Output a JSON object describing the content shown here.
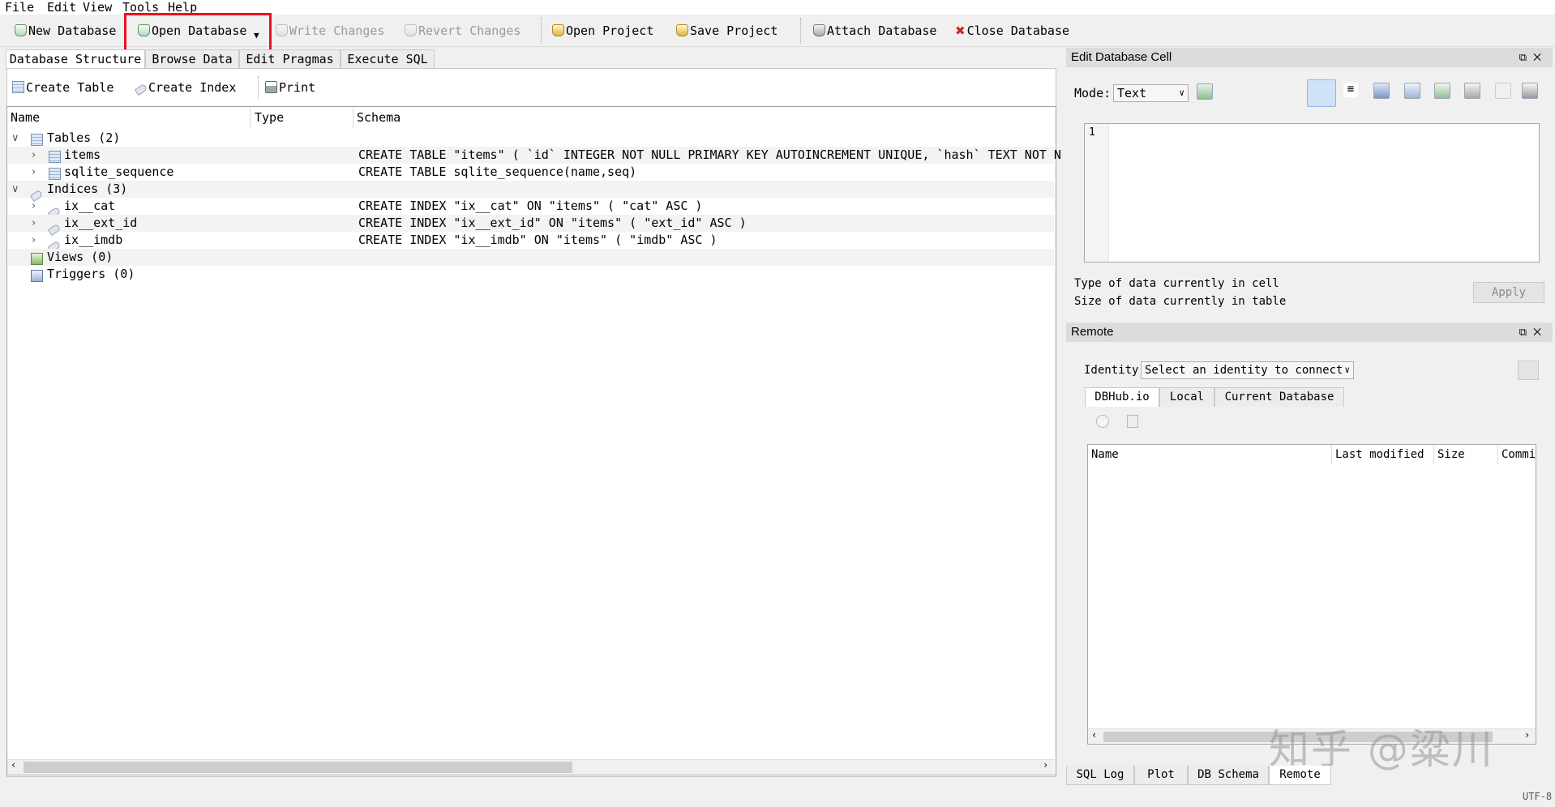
{
  "menu": [
    "File",
    "Edit",
    "View",
    "Tools",
    "Help"
  ],
  "toolbar": {
    "new_database": "New Database",
    "open_database": "Open Database",
    "write_changes": "Write Changes",
    "revert_changes": "Revert Changes",
    "open_project": "Open Project",
    "save_project": "Save Project",
    "attach_database": "Attach Database",
    "close_database": "Close Database"
  },
  "main_tabs": [
    "Database Structure",
    "Browse Data",
    "Edit Pragmas",
    "Execute SQL"
  ],
  "structure_toolbar": {
    "create_table": "Create Table",
    "create_index": "Create Index",
    "print": "Print"
  },
  "tree": {
    "headers": [
      "Name",
      "Type",
      "Schema"
    ],
    "rows": [
      {
        "name": "Tables (2)",
        "schema": ""
      },
      {
        "name": "items",
        "schema": "CREATE TABLE \"items\" ( `id` INTEGER NOT NULL PRIMARY KEY AUTOINCREMENT UNIQUE, `hash` TEXT NOT N"
      },
      {
        "name": "sqlite_sequence",
        "schema": "CREATE TABLE sqlite_sequence(name,seq)"
      },
      {
        "name": "Indices (3)",
        "schema": ""
      },
      {
        "name": "ix__cat",
        "schema": "CREATE INDEX \"ix__cat\" ON \"items\" ( \"cat\" ASC )"
      },
      {
        "name": "ix__ext_id",
        "schema": "CREATE INDEX \"ix__ext_id\" ON \"items\" ( \"ext_id\" ASC )"
      },
      {
        "name": "ix__imdb",
        "schema": "CREATE INDEX \"ix__imdb\" ON \"items\" ( \"imdb\" ASC )"
      },
      {
        "name": "Views (0)",
        "schema": ""
      },
      {
        "name": "Triggers (0)",
        "schema": ""
      }
    ]
  },
  "edit_cell": {
    "title": "Edit Database Cell",
    "mode_label": "Mode:",
    "mode_value": "Text",
    "line_number": "1",
    "type_info": "Type of data currently in cell",
    "size_info": "Size of data currently in table",
    "apply": "Apply"
  },
  "remote": {
    "title": "Remote",
    "identity_label": "Identity",
    "identity_value": "Select an identity to connect",
    "tabs": [
      "DBHub.io",
      "Local",
      "Current Database"
    ],
    "headers": [
      "Name",
      "Last modified",
      "Size",
      "Commi"
    ]
  },
  "bottom_tabs": [
    "SQL Log",
    "Plot",
    "DB Schema",
    "Remote"
  ],
  "status": {
    "encoding": "UTF-8"
  },
  "watermark": "知乎 @粱川"
}
